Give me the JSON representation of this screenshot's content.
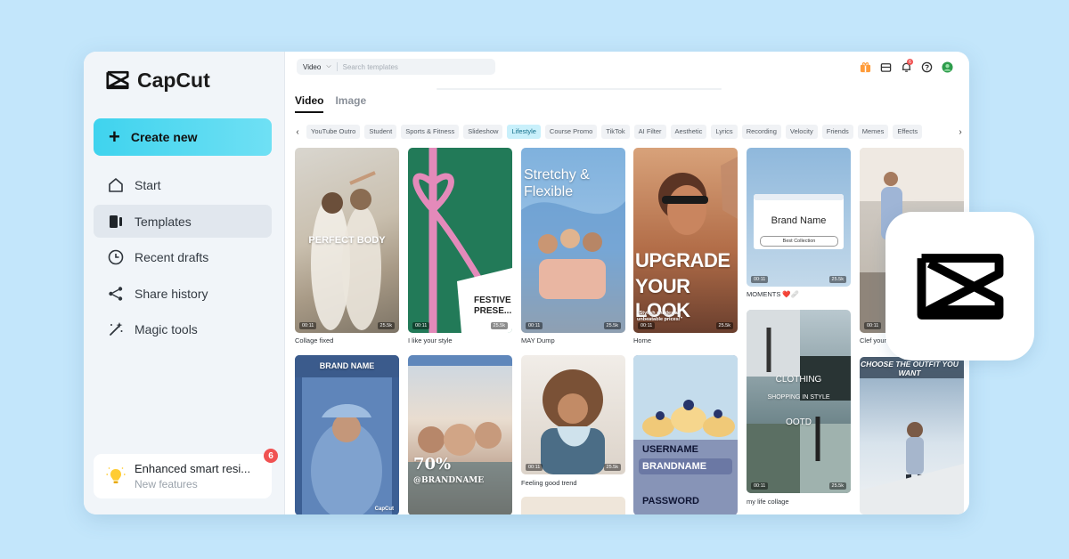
{
  "app": {
    "name": "CapCut"
  },
  "sidebar": {
    "create_label": "Create new",
    "items": [
      {
        "label": "Start",
        "icon": "home-icon"
      },
      {
        "label": "Templates",
        "icon": "templates-icon",
        "active": true
      },
      {
        "label": "Recent drafts",
        "icon": "clock-icon"
      },
      {
        "label": "Share history",
        "icon": "share-icon"
      },
      {
        "label": "Magic tools",
        "icon": "magic-wand-icon"
      }
    ],
    "promo": {
      "title": "Enhanced smart resi...",
      "subtitle": "New features",
      "badge": "6"
    }
  },
  "header": {
    "search_type": "Video",
    "search_placeholder": "Search templates",
    "notification_badge": "6"
  },
  "tabs": [
    {
      "label": "Video",
      "active": true
    },
    {
      "label": "Image",
      "active": false
    }
  ],
  "categories": [
    "YouTube Outro",
    "Student",
    "Sports & Fitness",
    "Slideshow",
    "Lifestyle",
    "Course Promo",
    "TikTok",
    "AI Filter",
    "Aesthetic",
    "Lyrics",
    "Recording",
    "Velocity",
    "Friends",
    "Memes",
    "Effects"
  ],
  "active_category": "Lifestyle",
  "templates": {
    "t1": {
      "caption": "Collage fixed",
      "overlay": "PERFECT BODY",
      "duration": "00:11",
      "likes": "25.5k"
    },
    "t2": {
      "caption": "I like your style",
      "overlay": "FESTIVE PRESE...",
      "duration": "00:11",
      "likes": "25.5k"
    },
    "t3": {
      "caption": "MAY Dump",
      "overlay": "Stretchy & Flexible",
      "duration": "00:11",
      "likes": "25.5k"
    },
    "t4": {
      "caption": "Home",
      "overlay_line1": "UPGRADE",
      "overlay_line2": "YOUR LOOK",
      "sub": "\"Stylish shades at unbeatable prices!\"",
      "duration": "00:11",
      "likes": "25.5k"
    },
    "t5": {
      "caption": "MOMENTS ❤️🩹",
      "overlay": "Brand Name",
      "button": "Best Collection",
      "duration": "00:11",
      "likes": "25.5k"
    },
    "t6": {
      "caption": "Clef your",
      "duration": "00:11"
    },
    "t7": {
      "overlay": "BRAND NAME",
      "watermark": "CapCut"
    },
    "t8": {
      "overlay_pct": "70%",
      "overlay_brand": "@BRANDNAME"
    },
    "t9": {
      "caption": "Feeling good trend",
      "duration": "00:11",
      "likes": "25.5k"
    },
    "t10": {
      "label1": "USERNAME",
      "value1": "BRANDNAME",
      "label2": "PASSWORD"
    },
    "t11": {
      "caption": "my life collage",
      "overlay1": "CLOTHING",
      "overlay2": "SHOPPING IN STYLE",
      "overlay3": "OOTD",
      "duration": "00:11",
      "likes": "25.5k"
    },
    "t12": {
      "overlay": "CHOOSE THE OUTFIT YOU WANT"
    }
  }
}
